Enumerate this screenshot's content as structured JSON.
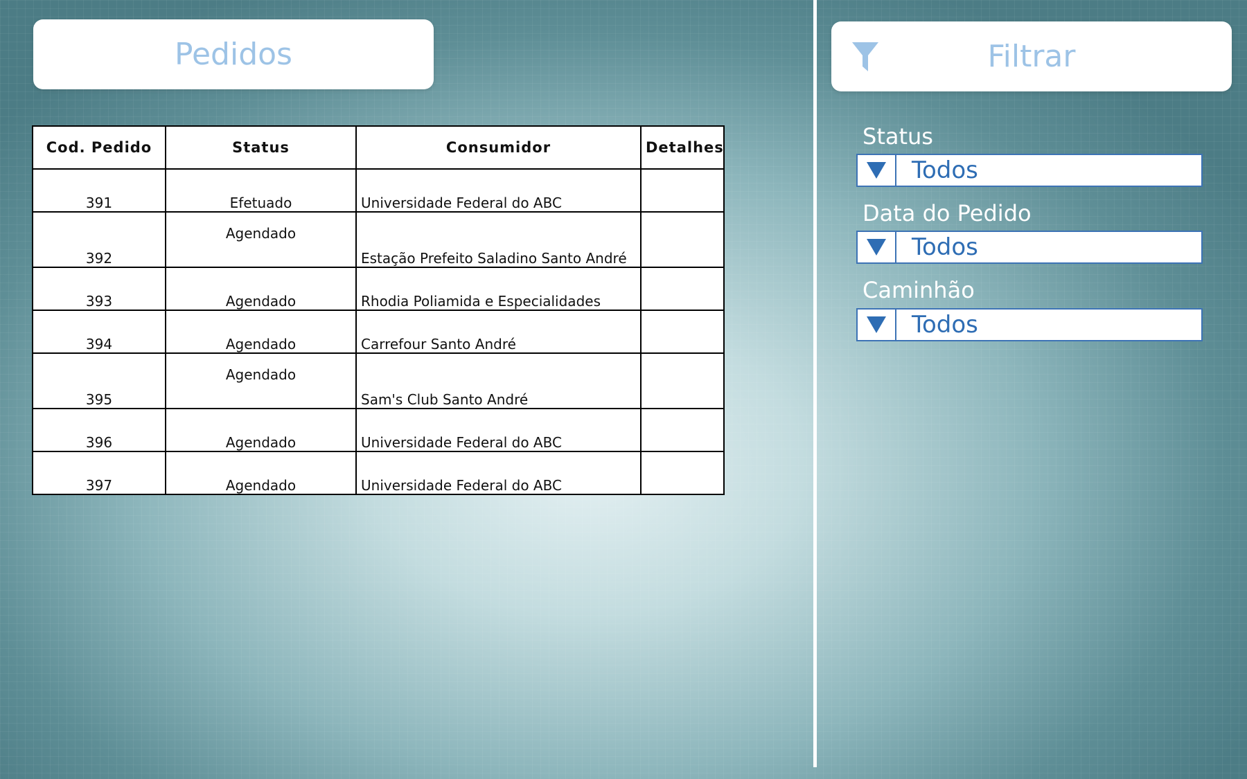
{
  "colors": {
    "title_text": "#9dc3e6",
    "dropdown_border": "#3d73b5",
    "dropdown_text": "#2e6db4"
  },
  "pedidos_panel": {
    "title": "Pedidos",
    "table": {
      "columns": [
        "Cod. Pedido",
        "Status",
        "Consumidor",
        "Detalhes"
      ],
      "rows": [
        {
          "id": "391",
          "status": "Efetuado",
          "consumidor": "Universidade Federal do ABC",
          "detalhes": ""
        },
        {
          "id": "392",
          "status": "Agendado",
          "consumidor": "Estação Prefeito Saladino Santo André",
          "detalhes": ""
        },
        {
          "id": "393",
          "status": "Agendado",
          "consumidor": "Rhodia Poliamida e Especialidades",
          "detalhes": ""
        },
        {
          "id": "394",
          "status": "Agendado",
          "consumidor": "Carrefour Santo André",
          "detalhes": ""
        },
        {
          "id": "395",
          "status": "Agendado",
          "consumidor": "Sam's Club Santo André",
          "detalhes": ""
        },
        {
          "id": "396",
          "status": "Agendado",
          "consumidor": "Universidade Federal do ABC",
          "detalhes": ""
        },
        {
          "id": "397",
          "status": "Agendado",
          "consumidor": "Universidade Federal do ABC",
          "detalhes": ""
        }
      ]
    }
  },
  "filter_panel": {
    "title": "Filtrar",
    "title_icon": "filter-funnel-icon",
    "filters": [
      {
        "label": "Status",
        "value": "Todos",
        "icon": "dropdown-arrow-icon"
      },
      {
        "label": "Data do Pedido",
        "value": "Todos",
        "icon": "dropdown-arrow-icon"
      },
      {
        "label": "Caminhão",
        "value": "Todos",
        "icon": "dropdown-arrow-icon"
      }
    ]
  }
}
